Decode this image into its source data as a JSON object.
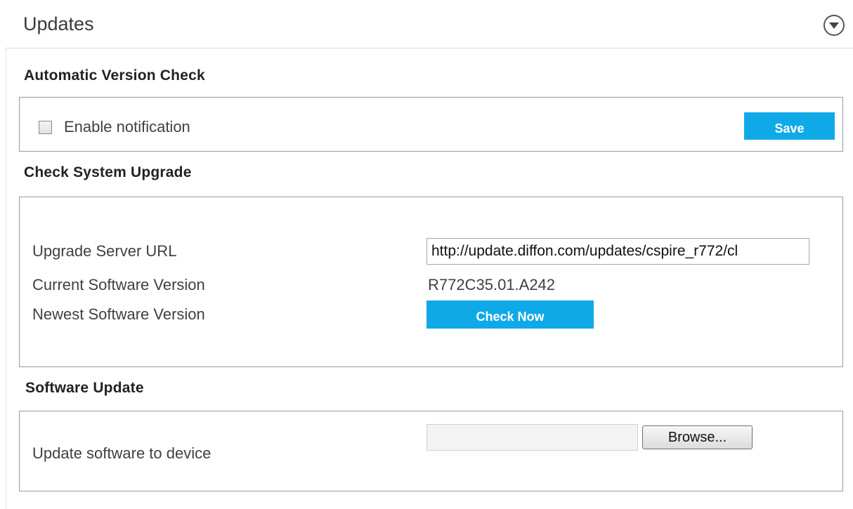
{
  "header": {
    "title": "Updates",
    "toggle_icon": "chevron-down-circle-icon"
  },
  "automatic_version_check": {
    "heading": "Automatic Version Check",
    "enable_notification_label": "Enable notification",
    "enable_notification_checked": false,
    "save_label": "Save"
  },
  "check_system_upgrade": {
    "heading": "Check System Upgrade",
    "server_url_label": "Upgrade Server URL",
    "server_url_value": "http://update.diffon.com/updates/cspire_r772/cl",
    "current_version_label": "Current Software Version",
    "current_version_value": "R772C35.01.A242",
    "newest_version_label": "Newest Software Version",
    "check_now_label": "Check Now"
  },
  "software_update": {
    "heading": "Software Update",
    "update_label": "Update software to device",
    "file_value": "",
    "browse_label": "Browse..."
  },
  "colors": {
    "accent": "#10a9e8",
    "box_border": "#9a9a9a",
    "text": "#404040"
  }
}
